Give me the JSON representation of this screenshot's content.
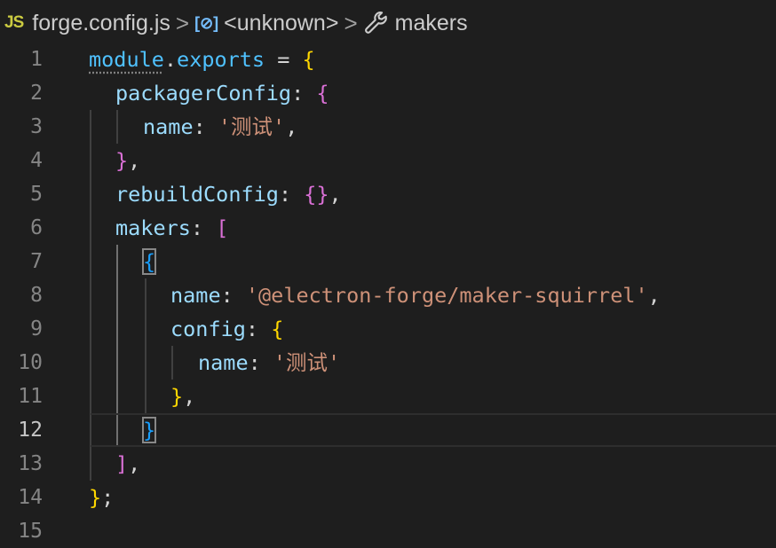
{
  "breadcrumb": {
    "file_icon": "JS",
    "file": "forge.config.js",
    "symbol_icon": "[⊘]",
    "symbol": "<unknown>",
    "property_icon": "wrench-icon",
    "property": "makers",
    "separator": ">"
  },
  "editor": {
    "current_line": 12,
    "line_numbers": [
      "1",
      "2",
      "3",
      "4",
      "5",
      "6",
      "7",
      "8",
      "9",
      "10",
      "11",
      "12",
      "13",
      "14",
      "15"
    ],
    "tokens": {
      "l1_module": "module",
      "l1_dot": ".",
      "l1_exports": "exports",
      "l1_eq": " = ",
      "l1_brace": "{",
      "l2_key": "packagerConfig",
      "l2_colon": ": ",
      "l2_brace": "{",
      "l3_key": "name",
      "l3_colon": ": ",
      "l3_str": "'测试'",
      "l3_comma": ",",
      "l4_brace": "}",
      "l4_comma": ",",
      "l5_key": "rebuildConfig",
      "l5_colon": ": ",
      "l5_braces": "{}",
      "l5_comma": ",",
      "l6_key": "makers",
      "l6_colon": ": ",
      "l6_bracket": "[",
      "l7_brace": "{",
      "l8_key": "name",
      "l8_colon": ": ",
      "l8_str": "'@electron-forge/maker-squirrel'",
      "l8_comma": ",",
      "l9_key": "config",
      "l9_colon": ": ",
      "l9_brace": "{",
      "l10_key": "name",
      "l10_colon": ": ",
      "l10_str": "'测试'",
      "l11_brace": "}",
      "l11_comma": ",",
      "l12_brace": "}",
      "l13_bracket": "]",
      "l13_comma": ",",
      "l14_brace": "}",
      "l14_semi": ";"
    }
  },
  "colors": {
    "background": "#1e1e1e",
    "line_number": "#858585",
    "variable": "#4fc1ff",
    "property": "#9cdcfe",
    "string": "#ce9178",
    "bracket_level1": "#ffd700",
    "bracket_level2": "#da70d6",
    "bracket_level3": "#179fff"
  }
}
